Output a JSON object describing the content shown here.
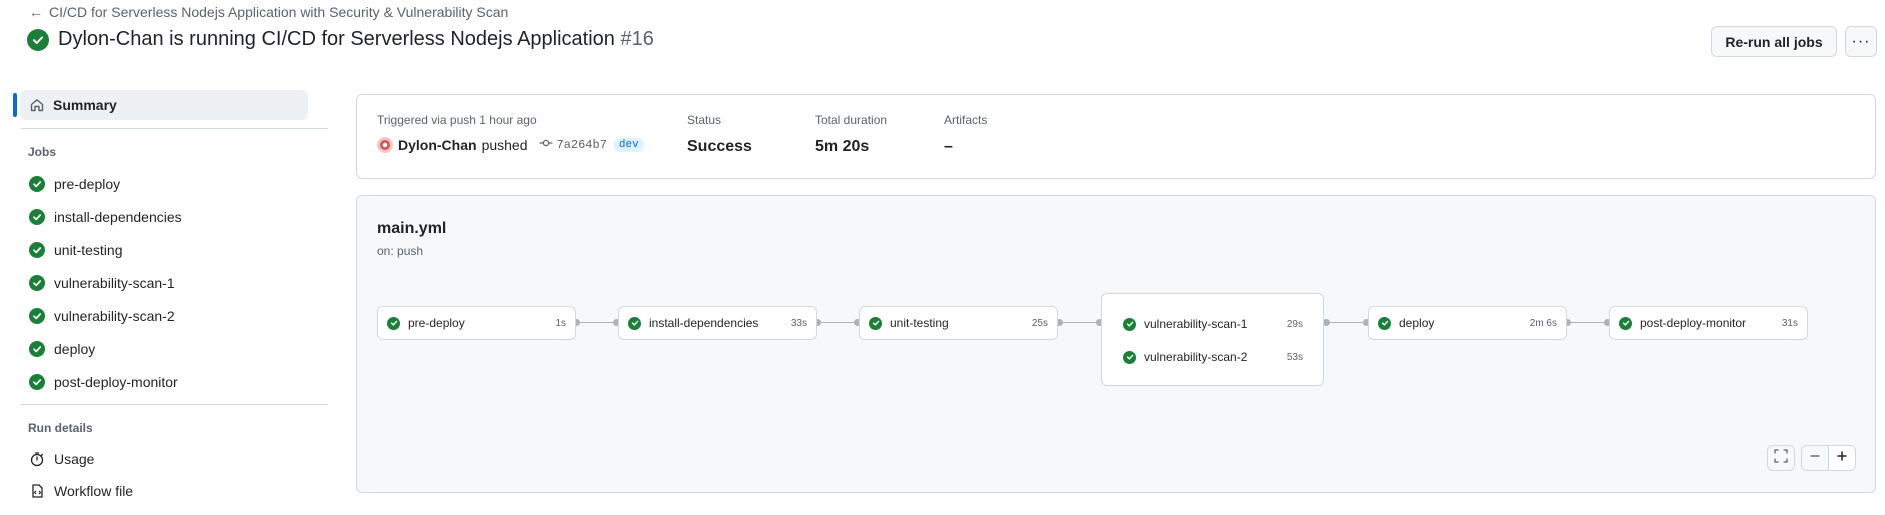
{
  "header": {
    "back_label": "CI/CD for Serverless Nodejs Application with Security & Vulnerability Scan",
    "title": "Dylon-Chan is running CI/CD for Serverless Nodejs Application",
    "run_number": "#16",
    "rerun_label": "Re-run all jobs",
    "more_label": "···"
  },
  "sidebar": {
    "summary_label": "Summary",
    "jobs_heading": "Jobs",
    "jobs": [
      {
        "label": "pre-deploy"
      },
      {
        "label": "install-dependencies"
      },
      {
        "label": "unit-testing"
      },
      {
        "label": "vulnerability-scan-1"
      },
      {
        "label": "vulnerability-scan-2"
      },
      {
        "label": "deploy"
      },
      {
        "label": "post-deploy-monitor"
      }
    ],
    "run_details_heading": "Run details",
    "usage_label": "Usage",
    "workflow_file_label": "Workflow file"
  },
  "summary": {
    "trigger_label": "Triggered via push 1 hour ago",
    "user": "Dylon-Chan",
    "action": "pushed",
    "commit": "7a264b7",
    "branch": "dev",
    "status_label": "Status",
    "status_value": "Success",
    "duration_label": "Total duration",
    "duration_value": "5m 20s",
    "artifacts_label": "Artifacts",
    "artifacts_value": "–"
  },
  "workflow": {
    "file": "main.yml",
    "trigger": "on: push",
    "nodes": [
      {
        "name": "pre-deploy",
        "duration": "1s"
      },
      {
        "name": "install-dependencies",
        "duration": "33s"
      },
      {
        "name": "unit-testing",
        "duration": "25s"
      },
      {
        "name": "deploy",
        "duration": "2m 6s"
      },
      {
        "name": "post-deploy-monitor",
        "duration": "31s"
      }
    ],
    "group": [
      {
        "name": "vulnerability-scan-1",
        "duration": "29s"
      },
      {
        "name": "vulnerability-scan-2",
        "duration": "53s"
      }
    ]
  },
  "colors": {
    "success": "#1a7f37",
    "accent": "#0969da",
    "border": "#d1d9e0",
    "muted": "#59636e"
  }
}
